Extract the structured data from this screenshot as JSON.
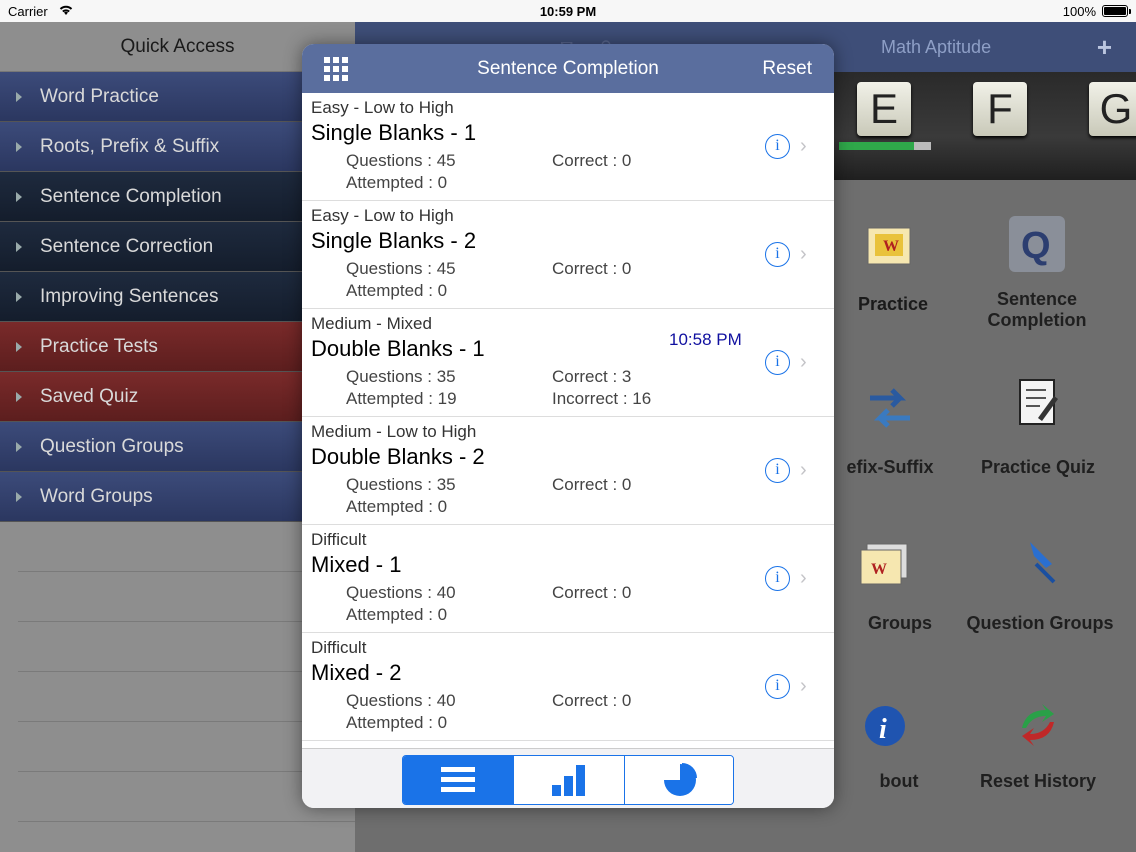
{
  "status_bar": {
    "carrier": "Carrier",
    "time": "10:59 PM",
    "battery": "100%"
  },
  "sidebar": {
    "title": "Quick Access",
    "items": [
      {
        "label": "Word Practice",
        "color": "#3c4b7a"
      },
      {
        "label": "Roots, Prefix & Suffix",
        "color": "#3c4b7a"
      },
      {
        "label": "Sentence Completion",
        "color": "#1e2a3e"
      },
      {
        "label": "Sentence Correction",
        "color": "#1e2a3e"
      },
      {
        "label": "Improving Sentences",
        "color": "#1e2a3e"
      },
      {
        "label": "Practice Tests",
        "color": "#7a2a2a"
      },
      {
        "label": "Saved Quiz",
        "color": "#7a2a2a"
      },
      {
        "label": "Question Groups",
        "color": "#3c4b7a"
      },
      {
        "label": "Word Groups",
        "color": "#3c4b7a"
      }
    ]
  },
  "background_app": {
    "nav_title": "Math Aptitude",
    "plus": "+",
    "letters": [
      "E",
      "F",
      "G"
    ],
    "progress_fraction": 0.82,
    "grid": [
      {
        "label": "Practice",
        "icon": "word-icon"
      },
      {
        "label": "Sentence Completion",
        "icon": "q-icon"
      },
      {
        "label": "efix-Suffix",
        "icon": "arrows-icon"
      },
      {
        "label": "Practice Quiz",
        "icon": "notepad-icon"
      },
      {
        "label": "Groups",
        "icon": "word-groups-icon"
      },
      {
        "label": "Question Groups",
        "icon": "pushpin-icon"
      },
      {
        "label": "bout",
        "icon": "info-icon"
      },
      {
        "label": "Reset History",
        "icon": "reset-arrows-icon"
      }
    ]
  },
  "modal": {
    "title": "Sentence Completion",
    "reset_label": "Reset",
    "rows": [
      {
        "level": "Easy - Low to High",
        "name": "Single Blanks - 1",
        "questions": "Questions : 45",
        "attempted": "Attempted : 0",
        "correct": "Correct : 0",
        "incorrect": "",
        "stamp": ""
      },
      {
        "level": "Easy - Low to High",
        "name": "Single Blanks - 2",
        "questions": "Questions : 45",
        "attempted": "Attempted : 0",
        "correct": "Correct : 0",
        "incorrect": "",
        "stamp": ""
      },
      {
        "level": "Medium - Mixed",
        "name": "Double Blanks - 1",
        "questions": "Questions : 35",
        "attempted": "Attempted : 19",
        "correct": "Correct : 3",
        "incorrect": "Incorrect : 16",
        "stamp": "10:58 PM"
      },
      {
        "level": "Medium - Low to High",
        "name": "Double Blanks - 2",
        "questions": "Questions : 35",
        "attempted": "Attempted : 0",
        "correct": "Correct : 0",
        "incorrect": "",
        "stamp": ""
      },
      {
        "level": "Difficult",
        "name": "Mixed - 1",
        "questions": "Questions : 40",
        "attempted": "Attempted : 0",
        "correct": "Correct : 0",
        "incorrect": "",
        "stamp": ""
      },
      {
        "level": "Difficult",
        "name": "Mixed - 2",
        "questions": "Questions : 40",
        "attempted": "Attempted : 0",
        "correct": "Correct : 0",
        "incorrect": "",
        "stamp": ""
      }
    ],
    "segments": [
      {
        "icon": "list-icon",
        "active": true
      },
      {
        "icon": "bar-chart-icon",
        "active": false
      },
      {
        "icon": "pie-chart-icon",
        "active": false
      }
    ],
    "accent": "#1a73e8"
  }
}
